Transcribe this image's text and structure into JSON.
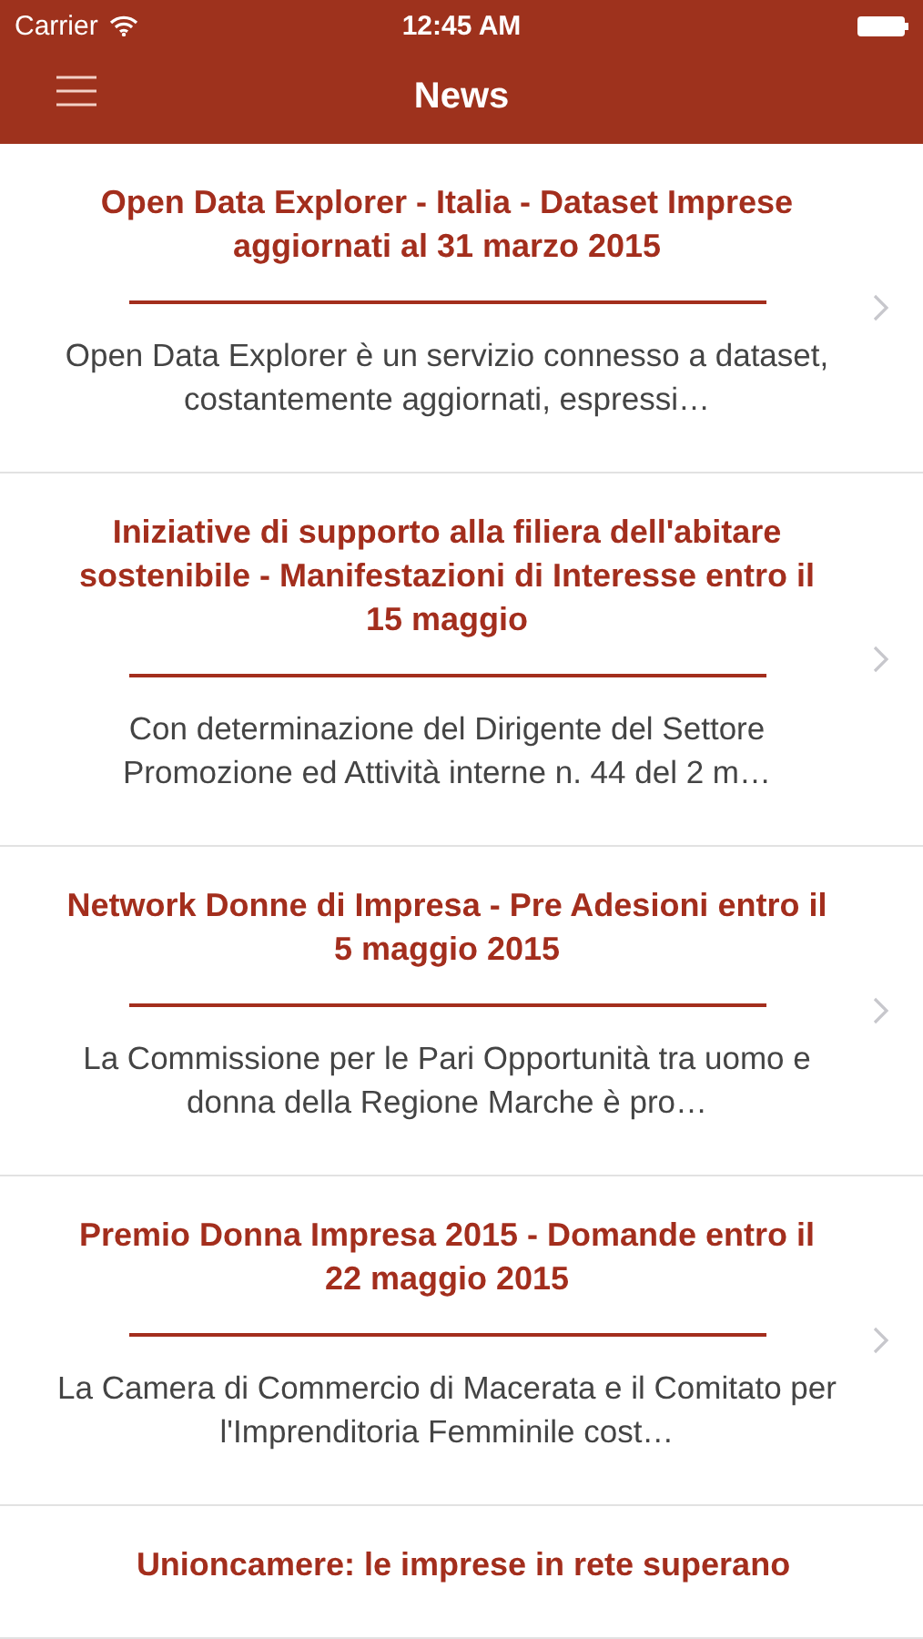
{
  "status_bar": {
    "carrier": "Carrier",
    "time": "12:45 AM"
  },
  "nav_bar": {
    "title": "News"
  },
  "news": [
    {
      "title": "Open Data Explorer - Italia - Dataset Imprese aggiornati al 31 marzo 2015",
      "summary": "Open Data Explorer è un servizio connesso a dataset, costantemente aggiornati, espressi…"
    },
    {
      "title": "Iniziative di supporto alla filiera dell'abitare sostenibile - Manifestazioni di Interesse entro il 15 maggio",
      "summary": "Con determinazione del Dirigente del Settore Promozione ed Attività interne n. 44 del 2 m…"
    },
    {
      "title": "Network Donne di Impresa - Pre Adesioni entro il 5 maggio 2015",
      "summary": "La Commissione per le Pari Opportunità tra uomo e donna della Regione Marche è pro…"
    },
    {
      "title": "Premio Donna Impresa 2015 - Domande entro il 22 maggio 2015",
      "summary": "La Camera di Commercio di Macerata e il Comitato per l'Imprenditoria Femminile cost…"
    },
    {
      "title": "Unioncamere: le imprese in rete superano"
    }
  ]
}
